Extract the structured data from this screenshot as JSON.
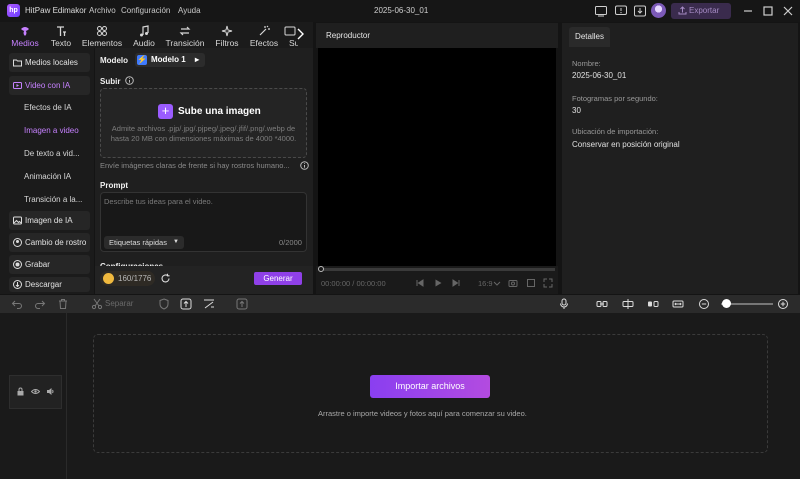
{
  "titlebar": {
    "app_name": "HitPaw Edimakor",
    "logo_text": "hp",
    "menu": [
      "Archivo",
      "Configuración",
      "Ayuda"
    ],
    "project_name": "2025-06-30_01",
    "export_label": "Exportar"
  },
  "media_tabs": [
    {
      "label": "Medios",
      "icon": "media-icon"
    },
    {
      "label": "Texto",
      "icon": "text-icon"
    },
    {
      "label": "Elementos",
      "icon": "elements-icon"
    },
    {
      "label": "Audio",
      "icon": "audio-icon"
    },
    {
      "label": "Transición",
      "icon": "transition-icon"
    },
    {
      "label": "Filtros",
      "icon": "filters-icon"
    },
    {
      "label": "Efectos",
      "icon": "effects-icon"
    },
    {
      "label": "Su",
      "icon": "subtitles-icon"
    }
  ],
  "leftnav": {
    "local_media": "Medios locales",
    "ai_video": "Video con IA",
    "sub_items": [
      "Efectos de IA",
      "Imagen a video",
      "De texto a vid...",
      "Animación IA",
      "Transición a la..."
    ],
    "ai_image": "Imagen de IA",
    "face_swap": "Cambio de rostro",
    "record": "Grabar",
    "download": "Descargar"
  },
  "center": {
    "model_label": "Modelo",
    "model_value": "Modelo 1",
    "upload_label": "Subir",
    "upload_title": "Sube una imagen",
    "upload_desc": "Admite archivos .pjp/.jpg/.pjpeg/.jpeg/.jfif/.png/.webp de hasta 20 MB con dimensiones máximas de 4000 *4000.",
    "upload_hint": "Envíe imágenes claras de frente si hay rostros humano...",
    "prompt_label": "Prompt",
    "prompt_placeholder": "Describe tus ideas para el video.",
    "quick_tags": "Etiquetas rápidas",
    "char_count": "0/2000",
    "settings_label": "Configuraciones",
    "credits": "160/1776",
    "generate": "Generar"
  },
  "player": {
    "title": "Reproductor",
    "timecode": "00:00:00 / 00:00:00",
    "ratio": "16:9"
  },
  "details": {
    "tab": "Detalles",
    "name_label": "Nombre:",
    "name_value": "2025-06-30_01",
    "fps_label": "Fotogramas por segundo:",
    "fps_value": "30",
    "location_label": "Ubicación de importación:",
    "location_value": "Conservar en posición original"
  },
  "toolbar": {
    "cut_label": "Separar",
    "zoom_level": 0.1
  },
  "timeline": {
    "import_btn": "Importar archivos",
    "hint": "Arrastre o importe videos y fotos aquí para comenzar su video."
  },
  "colors": {
    "accent": "#c681ff",
    "generate": "#8f40e8",
    "import_btn": "#8a3ff0"
  }
}
